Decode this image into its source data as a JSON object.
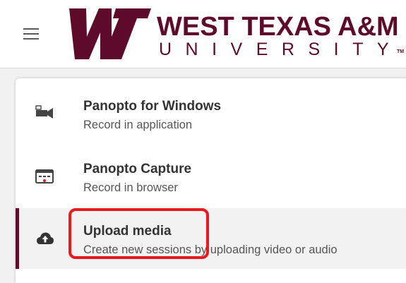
{
  "header": {
    "logo_mark": "WT",
    "brand_line1": "WEST TEXAS A&M",
    "brand_line2": "UNIVERSITY",
    "brand_tm": "TM",
    "brand_color": "#5e0a2a",
    "menu_icon": "hamburger-icon"
  },
  "menu": {
    "items": [
      {
        "title": "Panopto for Windows",
        "subtitle": "Record in application",
        "icon": "video-camera-icon"
      },
      {
        "title": "Panopto Capture",
        "subtitle": "Record in browser",
        "icon": "browser-record-icon"
      },
      {
        "title": "Upload media",
        "subtitle": "Create new sessions by uploading video or audio",
        "icon": "cloud-upload-icon",
        "active": true
      }
    ]
  },
  "annotation": {
    "highlight_color": "#e8191f"
  }
}
